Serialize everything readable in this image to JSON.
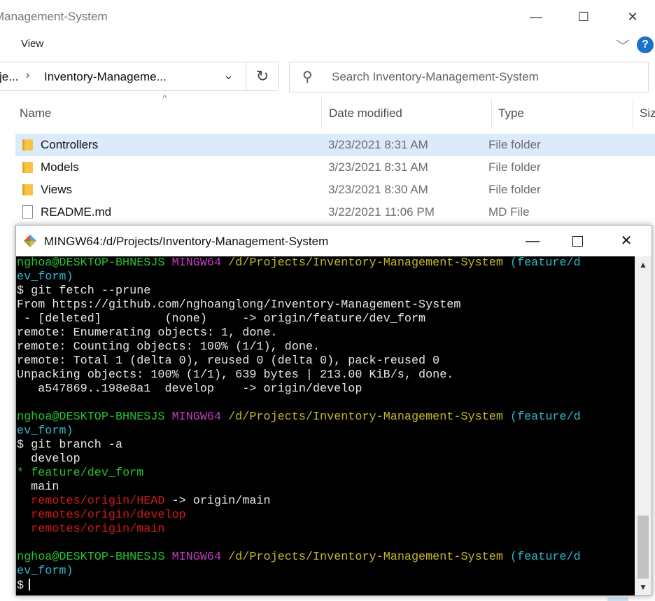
{
  "explorer": {
    "title": "Management-System",
    "ribbon_tab": "View",
    "address": {
      "parent_segment": "je...",
      "current_segment": "Inventory-Manageme...",
      "refresh_glyph": "↻"
    },
    "search_placeholder": "Search Inventory-Management-System",
    "columns": {
      "name": "Name",
      "date_modified": "Date modified",
      "type": "Type",
      "size": "Siz"
    },
    "files": [
      {
        "name": "Controllers",
        "date": "3/23/2021 8:31 AM",
        "type": "File folder",
        "icon": "folder-icon",
        "selected": true
      },
      {
        "name": "Models",
        "date": "3/23/2021 8:31 AM",
        "type": "File folder",
        "icon": "folder-icon",
        "selected": false
      },
      {
        "name": "Views",
        "date": "3/23/2021 8:30 AM",
        "type": "File folder",
        "icon": "folder-icon",
        "selected": false
      },
      {
        "name": "README.md",
        "date": "3/22/2021 11:06 PM",
        "type": "MD File",
        "icon": "file-icon",
        "selected": false
      }
    ]
  },
  "terminal": {
    "title": "MINGW64:/d/Projects/Inventory-Management-System",
    "prompt": {
      "user_host": "nghoa@DESKTOP-BHNESJS",
      "shell": "MINGW64",
      "path": "/d/Projects/Inventory-Management-System",
      "branch_part1": "(feature/d",
      "branch_part2": "ev_form)"
    },
    "fetch_cmd": "$ git fetch --prune",
    "fetch_output": [
      "From https://github.com/nghoanglong/Inventory-Management-System",
      " - [deleted]         (none)     -> origin/feature/dev_form",
      "remote: Enumerating objects: 1, done.",
      "remote: Counting objects: 100% (1/1), done.",
      "remote: Total 1 (delta 0), reused 0 (delta 0), pack-reused 0",
      "Unpacking objects: 100% (1/1), 639 bytes | 213.00 KiB/s, done.",
      "   a547869..198e8a1  develop    -> origin/develop"
    ],
    "branch_cmd": "$ git branch -a",
    "branches": {
      "develop": "  develop",
      "current_marker": "* ",
      "current": "feature/dev_form",
      "main": "  main",
      "remote_head": "remotes/origin/HEAD",
      "remote_head_target": " -> origin/main",
      "remote_develop": "remotes/origin/develop",
      "remote_main": "remotes/origin/main"
    },
    "final_prompt": "$"
  },
  "colors": {
    "selection": "#dcebfc",
    "terminal_bg": "#000000",
    "green": "#24c130",
    "magenta": "#c43cc4",
    "yellow": "#c2b72c",
    "cyan": "#2fb6c9",
    "red": "#d01818"
  }
}
